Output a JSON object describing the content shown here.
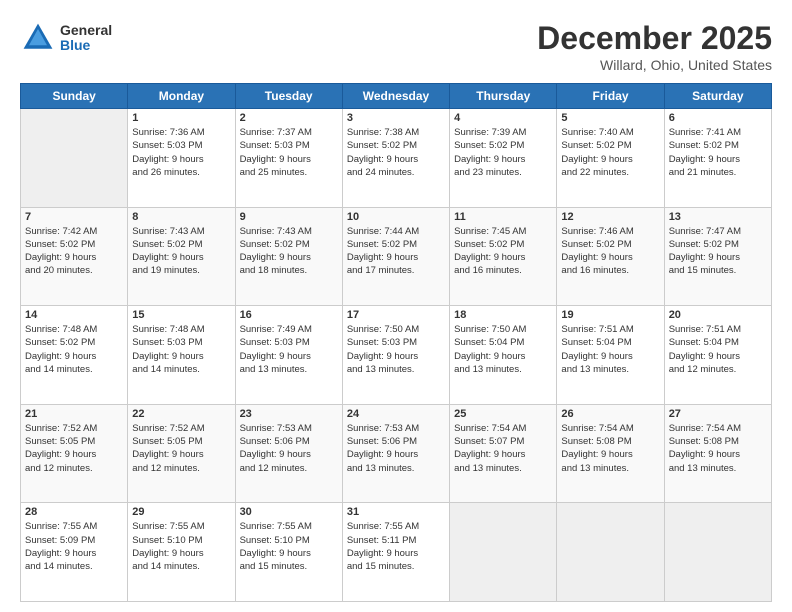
{
  "header": {
    "logo_general": "General",
    "logo_blue": "Blue",
    "month_title": "December 2025",
    "location": "Willard, Ohio, United States"
  },
  "days_of_week": [
    "Sunday",
    "Monday",
    "Tuesday",
    "Wednesday",
    "Thursday",
    "Friday",
    "Saturday"
  ],
  "weeks": [
    [
      {
        "day": "",
        "info": ""
      },
      {
        "day": "1",
        "info": "Sunrise: 7:36 AM\nSunset: 5:03 PM\nDaylight: 9 hours\nand 26 minutes."
      },
      {
        "day": "2",
        "info": "Sunrise: 7:37 AM\nSunset: 5:03 PM\nDaylight: 9 hours\nand 25 minutes."
      },
      {
        "day": "3",
        "info": "Sunrise: 7:38 AM\nSunset: 5:02 PM\nDaylight: 9 hours\nand 24 minutes."
      },
      {
        "day": "4",
        "info": "Sunrise: 7:39 AM\nSunset: 5:02 PM\nDaylight: 9 hours\nand 23 minutes."
      },
      {
        "day": "5",
        "info": "Sunrise: 7:40 AM\nSunset: 5:02 PM\nDaylight: 9 hours\nand 22 minutes."
      },
      {
        "day": "6",
        "info": "Sunrise: 7:41 AM\nSunset: 5:02 PM\nDaylight: 9 hours\nand 21 minutes."
      }
    ],
    [
      {
        "day": "7",
        "info": "Sunrise: 7:42 AM\nSunset: 5:02 PM\nDaylight: 9 hours\nand 20 minutes."
      },
      {
        "day": "8",
        "info": "Sunrise: 7:43 AM\nSunset: 5:02 PM\nDaylight: 9 hours\nand 19 minutes."
      },
      {
        "day": "9",
        "info": "Sunrise: 7:43 AM\nSunset: 5:02 PM\nDaylight: 9 hours\nand 18 minutes."
      },
      {
        "day": "10",
        "info": "Sunrise: 7:44 AM\nSunset: 5:02 PM\nDaylight: 9 hours\nand 17 minutes."
      },
      {
        "day": "11",
        "info": "Sunrise: 7:45 AM\nSunset: 5:02 PM\nDaylight: 9 hours\nand 16 minutes."
      },
      {
        "day": "12",
        "info": "Sunrise: 7:46 AM\nSunset: 5:02 PM\nDaylight: 9 hours\nand 16 minutes."
      },
      {
        "day": "13",
        "info": "Sunrise: 7:47 AM\nSunset: 5:02 PM\nDaylight: 9 hours\nand 15 minutes."
      }
    ],
    [
      {
        "day": "14",
        "info": "Sunrise: 7:48 AM\nSunset: 5:02 PM\nDaylight: 9 hours\nand 14 minutes."
      },
      {
        "day": "15",
        "info": "Sunrise: 7:48 AM\nSunset: 5:03 PM\nDaylight: 9 hours\nand 14 minutes."
      },
      {
        "day": "16",
        "info": "Sunrise: 7:49 AM\nSunset: 5:03 PM\nDaylight: 9 hours\nand 13 minutes."
      },
      {
        "day": "17",
        "info": "Sunrise: 7:50 AM\nSunset: 5:03 PM\nDaylight: 9 hours\nand 13 minutes."
      },
      {
        "day": "18",
        "info": "Sunrise: 7:50 AM\nSunset: 5:04 PM\nDaylight: 9 hours\nand 13 minutes."
      },
      {
        "day": "19",
        "info": "Sunrise: 7:51 AM\nSunset: 5:04 PM\nDaylight: 9 hours\nand 13 minutes."
      },
      {
        "day": "20",
        "info": "Sunrise: 7:51 AM\nSunset: 5:04 PM\nDaylight: 9 hours\nand 12 minutes."
      }
    ],
    [
      {
        "day": "21",
        "info": "Sunrise: 7:52 AM\nSunset: 5:05 PM\nDaylight: 9 hours\nand 12 minutes."
      },
      {
        "day": "22",
        "info": "Sunrise: 7:52 AM\nSunset: 5:05 PM\nDaylight: 9 hours\nand 12 minutes."
      },
      {
        "day": "23",
        "info": "Sunrise: 7:53 AM\nSunset: 5:06 PM\nDaylight: 9 hours\nand 12 minutes."
      },
      {
        "day": "24",
        "info": "Sunrise: 7:53 AM\nSunset: 5:06 PM\nDaylight: 9 hours\nand 13 minutes."
      },
      {
        "day": "25",
        "info": "Sunrise: 7:54 AM\nSunset: 5:07 PM\nDaylight: 9 hours\nand 13 minutes."
      },
      {
        "day": "26",
        "info": "Sunrise: 7:54 AM\nSunset: 5:08 PM\nDaylight: 9 hours\nand 13 minutes."
      },
      {
        "day": "27",
        "info": "Sunrise: 7:54 AM\nSunset: 5:08 PM\nDaylight: 9 hours\nand 13 minutes."
      }
    ],
    [
      {
        "day": "28",
        "info": "Sunrise: 7:55 AM\nSunset: 5:09 PM\nDaylight: 9 hours\nand 14 minutes."
      },
      {
        "day": "29",
        "info": "Sunrise: 7:55 AM\nSunset: 5:10 PM\nDaylight: 9 hours\nand 14 minutes."
      },
      {
        "day": "30",
        "info": "Sunrise: 7:55 AM\nSunset: 5:10 PM\nDaylight: 9 hours\nand 15 minutes."
      },
      {
        "day": "31",
        "info": "Sunrise: 7:55 AM\nSunset: 5:11 PM\nDaylight: 9 hours\nand 15 minutes."
      },
      {
        "day": "",
        "info": ""
      },
      {
        "day": "",
        "info": ""
      },
      {
        "day": "",
        "info": ""
      }
    ]
  ]
}
